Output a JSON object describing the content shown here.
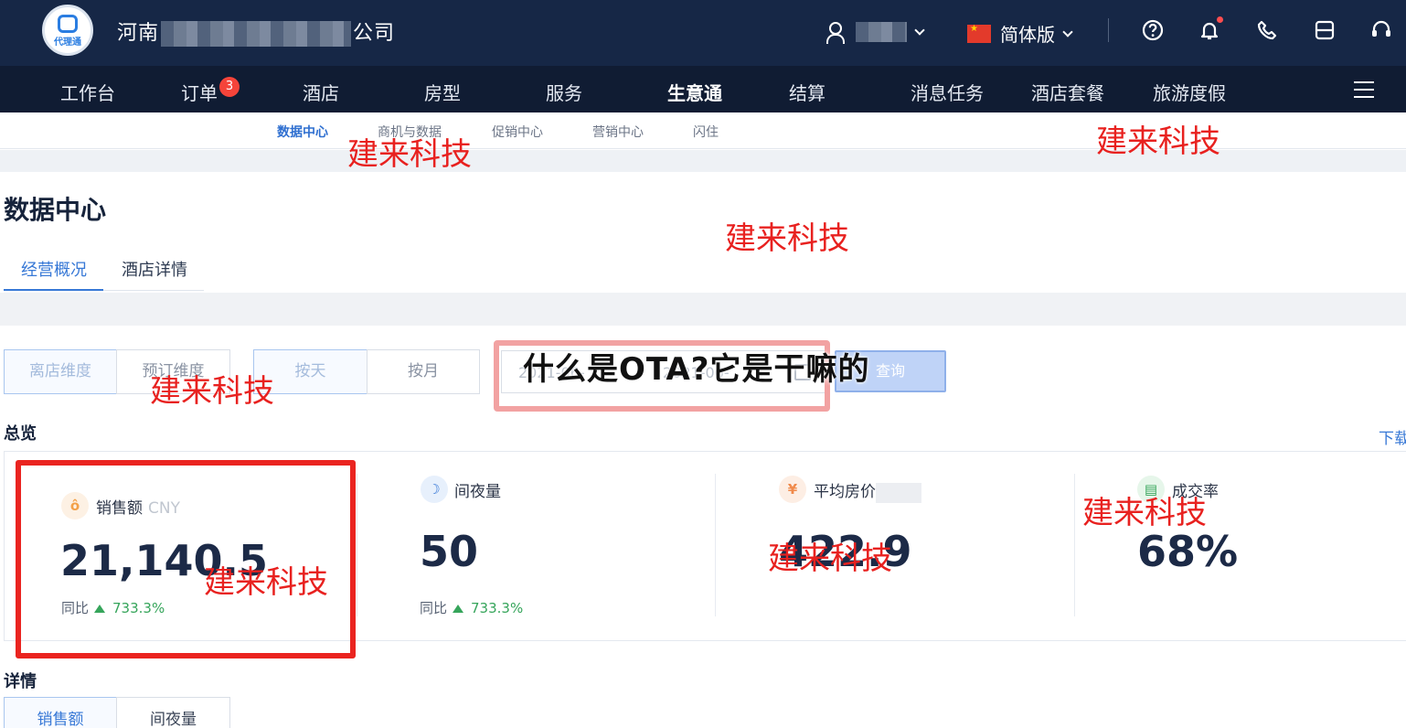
{
  "header": {
    "logo_text": "代理通",
    "company_start": "河南",
    "company_end": "公司",
    "language": "简体版"
  },
  "nav": {
    "items": [
      "工作台",
      "订单",
      "酒店",
      "房型",
      "服务",
      "生意通",
      "结算",
      "消息任务",
      "酒店套餐",
      "旅游度假"
    ],
    "active": "生意通",
    "order_badge": "3"
  },
  "subnav": {
    "items": [
      "数据中心",
      "商机与数据",
      "促销中心",
      "营销中心",
      "闪住"
    ],
    "active": "数据中心"
  },
  "page": {
    "title": "数据中心",
    "tabs": [
      "经营概况",
      "酒店详情"
    ],
    "active_tab": "经营概况"
  },
  "filters": {
    "dimension": [
      "离店维度",
      "预订维度"
    ],
    "granularity": [
      "按天",
      "按月"
    ],
    "date_start": "2021-06-",
    "date_end": "2021-06-",
    "query_label": "查询"
  },
  "overlay_title": "什么是OTA?它是干嘛的",
  "overview": {
    "label": "总览",
    "download_label": "下载",
    "metrics": [
      {
        "label": "销售额",
        "unit": "CNY",
        "value": "21,140.5",
        "yoy_label": "同比",
        "yoy": "733.3%",
        "icon": "money-bag-icon"
      },
      {
        "label": "间夜量",
        "unit": "",
        "value": "50",
        "yoy_label": "同比",
        "yoy": "733.3%",
        "icon": "moon-icon"
      },
      {
        "label": "平均房价",
        "unit": "",
        "value": "422.9",
        "yoy_label": "",
        "yoy": "",
        "icon": "yuan-icon"
      },
      {
        "label": "成交率",
        "unit": "",
        "value": "68%",
        "yoy_label": "",
        "yoy": "",
        "icon": "document-icon"
      }
    ]
  },
  "detail": {
    "label": "详情",
    "tabs": [
      "销售额",
      "间夜量"
    ]
  },
  "watermark": "建来科技",
  "colors": {
    "header_bg": "#162746",
    "nav_bg": "#101c33",
    "accent": "#3778d6",
    "watermark": "#e8211f",
    "positive": "#36a55b"
  }
}
